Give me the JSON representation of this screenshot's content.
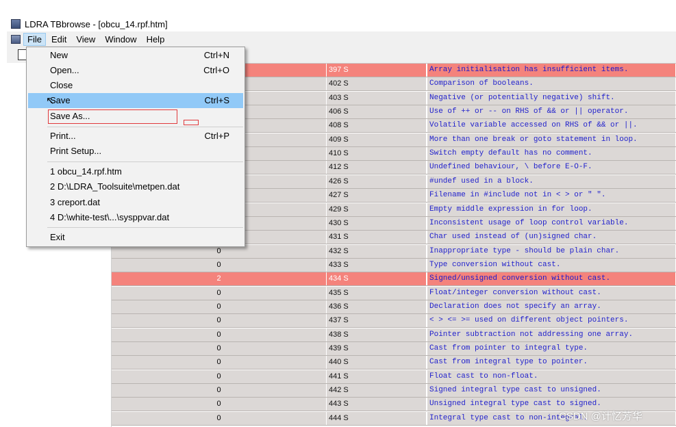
{
  "window": {
    "title": "LDRA TBbrowse - [obcu_14.rpf.htm]"
  },
  "menubar": {
    "items": [
      "File",
      "Edit",
      "View",
      "Window",
      "Help"
    ]
  },
  "file_menu": {
    "items": [
      {
        "label": "New",
        "shortcut": "Ctrl+N"
      },
      {
        "label": "Open...",
        "shortcut": "Ctrl+O"
      },
      {
        "label": "Close",
        "shortcut": ""
      },
      {
        "label": "Save",
        "shortcut": "Ctrl+S"
      },
      {
        "label": "Save As...",
        "shortcut": ""
      },
      {
        "label": "Print...",
        "shortcut": "Ctrl+P"
      },
      {
        "label": "Print Setup...",
        "shortcut": ""
      },
      {
        "label": "1 obcu_14.rpf.htm",
        "shortcut": ""
      },
      {
        "label": "2 D:\\LDRA_Toolsuite\\metpen.dat",
        "shortcut": ""
      },
      {
        "label": "3 creport.dat",
        "shortcut": ""
      },
      {
        "label": "4 D:\\white-test\\...\\sysppvar.dat",
        "shortcut": ""
      },
      {
        "label": "Exit",
        "shortcut": ""
      }
    ],
    "selected": "Save"
  },
  "table": {
    "rows": [
      {
        "count": "",
        "code": "397 S",
        "desc": "Array initialisation has insufficient items.",
        "highlight": true
      },
      {
        "count": "",
        "code": "402 S",
        "desc": "Comparison of booleans.",
        "highlight": false
      },
      {
        "count": "",
        "code": "403 S",
        "desc": "Negative (or potentially negative) shift.",
        "highlight": false
      },
      {
        "count": "",
        "code": "406 S",
        "desc": "Use of ++ or -- on RHS of && or || operator.",
        "highlight": false
      },
      {
        "count": "",
        "code": "408 S",
        "desc": "Volatile variable accessed on RHS of && or ||.",
        "highlight": false
      },
      {
        "count": "",
        "code": "409 S",
        "desc": "More than one break or goto statement in loop.",
        "highlight": false
      },
      {
        "count": "",
        "code": "410 S",
        "desc": "Switch empty default has no comment.",
        "highlight": false
      },
      {
        "count": "",
        "code": "412 S",
        "desc": "Undefined behaviour, \\ before E-O-F.",
        "highlight": false
      },
      {
        "count": "",
        "code": "426 S",
        "desc": "#undef used in a block.",
        "highlight": false
      },
      {
        "count": "",
        "code": "427 S",
        "desc": "Filename in #include not in < > or \" \".",
        "highlight": false
      },
      {
        "count": "",
        "code": "429 S",
        "desc": "Empty middle expression in for loop.",
        "highlight": false
      },
      {
        "count": "",
        "code": "430 S",
        "desc": "Inconsistent usage of loop control variable.",
        "highlight": false
      },
      {
        "count": "",
        "code": "431 S",
        "desc": "Char used instead of (un)signed char.",
        "highlight": false
      },
      {
        "count": "0",
        "code": "432 S",
        "desc": "Inappropriate type - should be plain char.",
        "highlight": false
      },
      {
        "count": "0",
        "code": "433 S",
        "desc": "Type conversion without cast.",
        "highlight": false
      },
      {
        "count": "2",
        "code": "434 S",
        "desc": "Signed/unsigned conversion without cast.",
        "highlight": true
      },
      {
        "count": "0",
        "code": "435 S",
        "desc": "Float/integer conversion without cast.",
        "highlight": false
      },
      {
        "count": "0",
        "code": "436 S",
        "desc": "Declaration does not specify an array.",
        "highlight": false
      },
      {
        "count": "0",
        "code": "437 S",
        "desc": "< > <= >= used on different object pointers.",
        "highlight": false
      },
      {
        "count": "0",
        "code": "438 S",
        "desc": "Pointer subtraction not addressing one array.",
        "highlight": false
      },
      {
        "count": "0",
        "code": "439 S",
        "desc": "Cast from pointer to integral type.",
        "highlight": false
      },
      {
        "count": "0",
        "code": "440 S",
        "desc": "Cast from integral type to pointer.",
        "highlight": false
      },
      {
        "count": "0",
        "code": "441 S",
        "desc": "Float cast to non-float.",
        "highlight": false
      },
      {
        "count": "0",
        "code": "442 S",
        "desc": "Signed integral type cast to unsigned.",
        "highlight": false
      },
      {
        "count": "0",
        "code": "443 S",
        "desc": "Unsigned integral type cast to signed.",
        "highlight": false
      },
      {
        "count": "0",
        "code": "444 S",
        "desc": "Integral type cast to non-integral.",
        "highlight": false
      }
    ]
  },
  "watermark": "CSDN @计忆芳华",
  "colors": {
    "highlight_row": "#f4837c",
    "row_bg": "#dcd8d6",
    "desc_text": "#2222cc",
    "menu_selected": "#91c9f7",
    "annotation_box": "#e0383b"
  }
}
